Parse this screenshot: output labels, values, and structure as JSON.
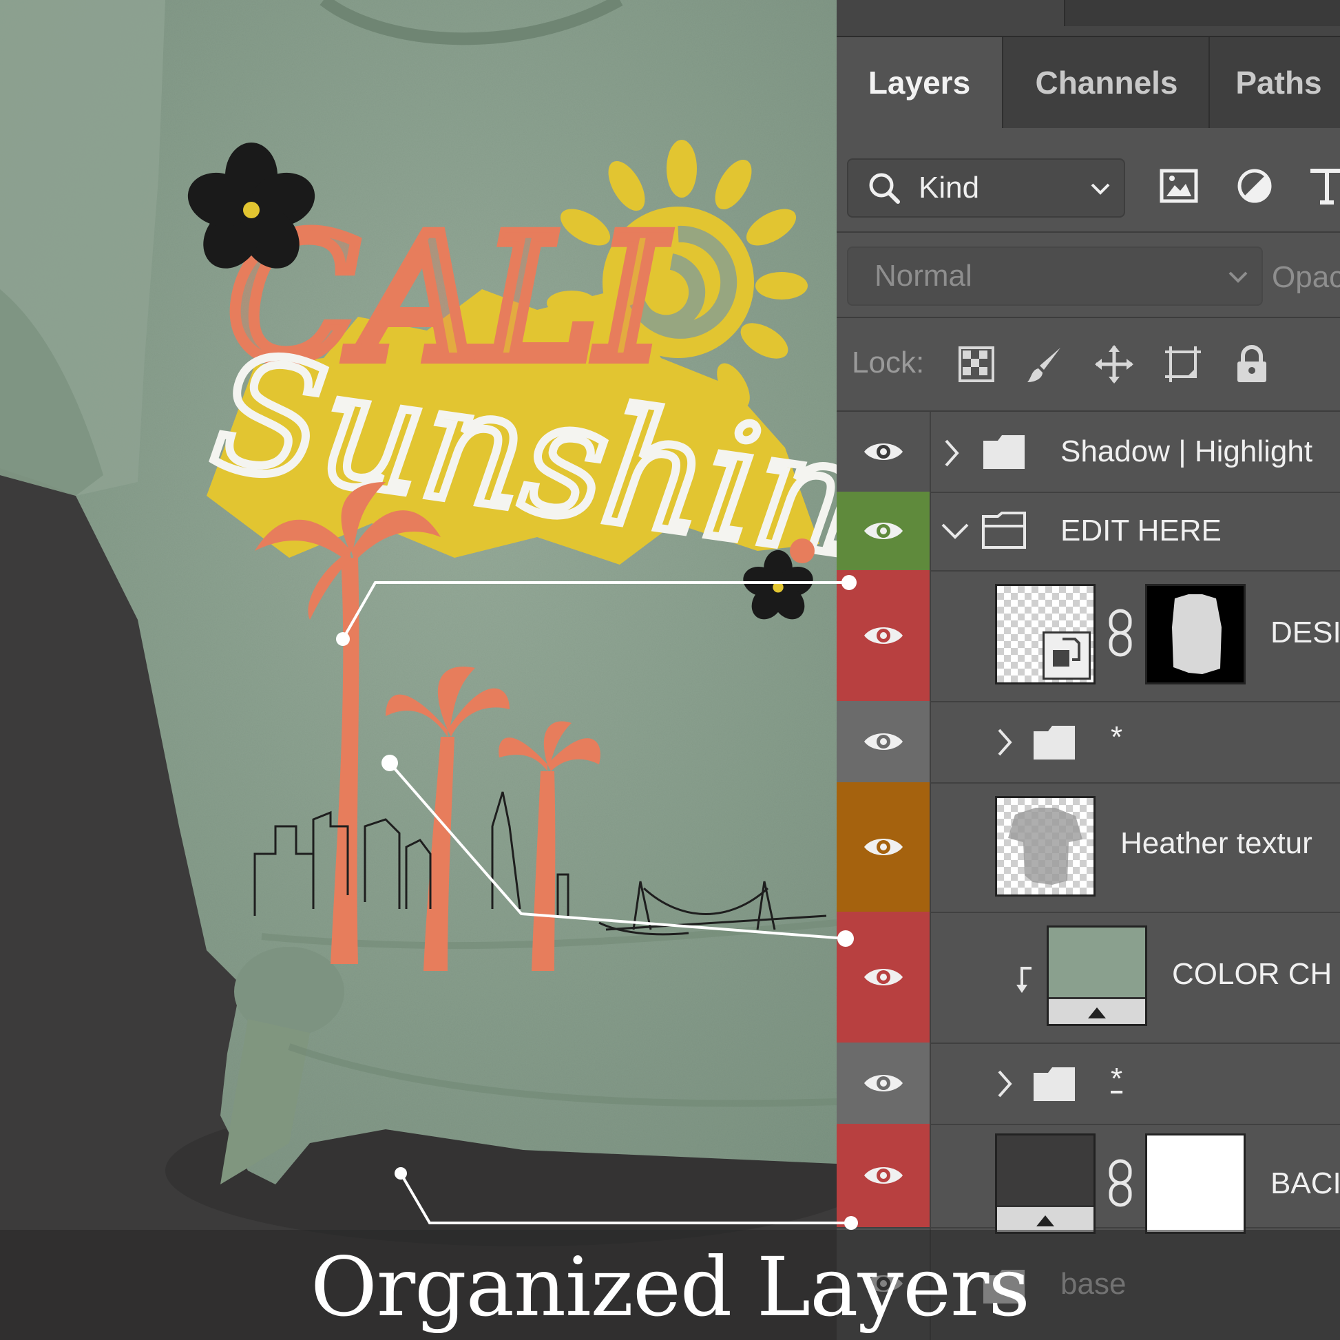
{
  "panel": {
    "tabs": [
      {
        "label": "Layers",
        "active": true
      },
      {
        "label": "Channels",
        "active": false
      },
      {
        "label": "Paths",
        "active": false
      }
    ],
    "filter": {
      "kind_label": "Kind",
      "icons": [
        "image-filter-icon",
        "adjustment-filter-icon",
        "type-filter-icon"
      ]
    },
    "blend_mode": "Normal",
    "opacity_label": "Opac",
    "lock_label": "Lock:",
    "lock_icons": [
      "lock-transparent-icon",
      "lock-brush-icon",
      "lock-position-icon",
      "lock-artboard-icon",
      "lock-all-icon"
    ],
    "layers": [
      {
        "name": "Shadow | Highlight",
        "type": "group",
        "expanded": false,
        "eye_color": "#535353"
      },
      {
        "name": "EDIT HERE",
        "type": "group",
        "expanded": true,
        "eye_color": "#5f8a3c"
      },
      {
        "name": "DESI",
        "type": "smart-object",
        "eye_color": "#b84040"
      },
      {
        "name": "*",
        "type": "group",
        "expanded": false,
        "eye_color": "#6b6b6b"
      },
      {
        "name": "Heather textur",
        "type": "pixel",
        "eye_color": "#a5620e"
      },
      {
        "name": "COLOR CH",
        "type": "fill-clipped",
        "eye_color": "#b84040"
      },
      {
        "name": "*",
        "type": "group",
        "expanded": false,
        "eye_color": "#6b6b6b"
      },
      {
        "name": "BACI",
        "type": "fill",
        "eye_color": "#b84040"
      },
      {
        "name": "base",
        "type": "group",
        "expanded": false,
        "eye_color": "#535353"
      }
    ]
  },
  "colors": {
    "shirt": "#8aa08e",
    "sun_yellow": "#e2c531",
    "coral": "#e77d5c",
    "white_script": "#f4f4f0",
    "panel_bg": "#535353"
  },
  "design": {
    "line1": "CALI",
    "line2": "Sunshine"
  },
  "caption": "Organized Layers"
}
